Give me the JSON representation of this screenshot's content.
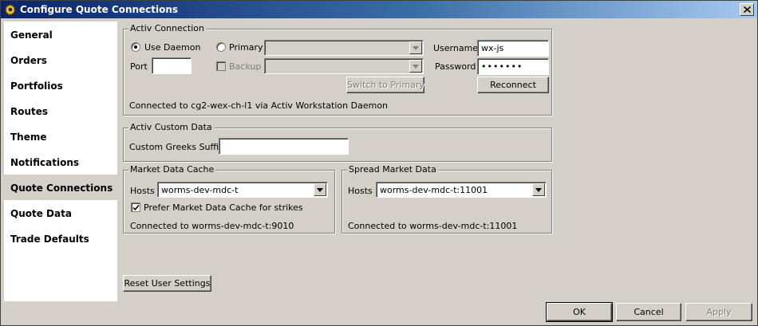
{
  "window": {
    "title": "Configure Quote Connections",
    "icon": "gear-icon"
  },
  "sidebar": {
    "items": [
      {
        "label": "General"
      },
      {
        "label": "Orders"
      },
      {
        "label": "Portfolios"
      },
      {
        "label": "Routes"
      },
      {
        "label": "Theme"
      },
      {
        "label": "Notifications"
      },
      {
        "label": "Quote Connections",
        "active": true
      },
      {
        "label": "Quote Data"
      },
      {
        "label": "Trade Defaults"
      }
    ]
  },
  "activ_connection": {
    "title": "Activ Connection",
    "use_daemon_label": "Use Daemon",
    "use_daemon_checked": true,
    "primary_label": "Primary",
    "primary_checked": false,
    "primary_value": "",
    "port_label": "Port",
    "port_value": "",
    "backup_label": "Backup",
    "backup_checked": false,
    "backup_value": "",
    "username_label": "Username",
    "username_value": "wx-js",
    "password_label": "Password",
    "password_value": "•••••••",
    "switch_to_primary_label": "Switch to Primary",
    "reconnect_label": "Reconnect",
    "status": "Connected to cg2-wex-ch-l1 via Activ Workstation Daemon"
  },
  "activ_custom_data": {
    "title": "Activ Custom Data",
    "custom_greeks_suffix_label": "Custom Greeks Suffix",
    "custom_greeks_suffix_value": ""
  },
  "market_data_cache": {
    "title": "Market Data Cache",
    "hosts_label": "Hosts",
    "hosts_value": "worms-dev-mdc-t",
    "prefer_label": "Prefer Market Data Cache for strikes",
    "prefer_checked": true,
    "status": "Connected to worms-dev-mdc-t:9010"
  },
  "spread_market_data": {
    "title": "Spread Market Data",
    "hosts_label": "Hosts",
    "hosts_value": "worms-dev-mdc-t:11001",
    "status": "Connected to worms-dev-mdc-t:11001"
  },
  "reset_user_settings_label": "Reset User Settings",
  "footer": {
    "ok_label": "OK",
    "cancel_label": "Cancel",
    "apply_label": "Apply"
  }
}
